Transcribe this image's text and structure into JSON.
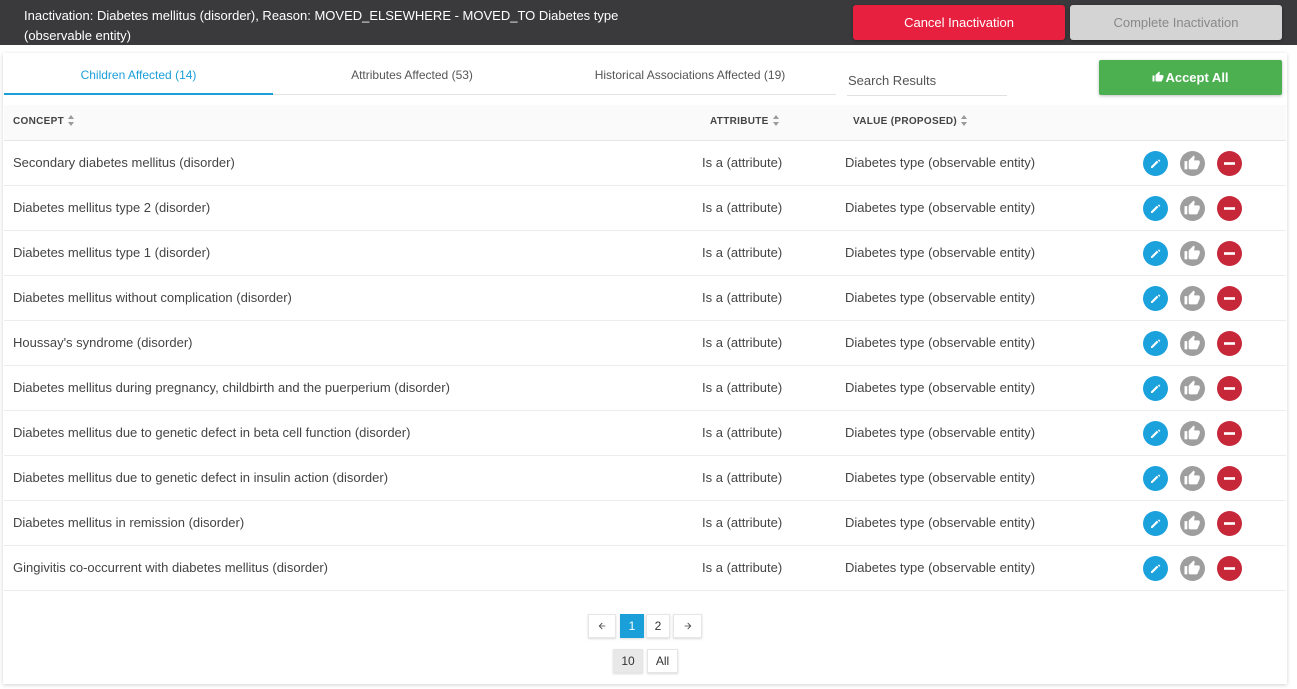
{
  "header": {
    "message": "Inactivation: Diabetes mellitus (disorder), Reason: MOVED_ELSEWHERE - MOVED_TO Diabetes type (observable entity)",
    "cancel_label": "Cancel Inactivation",
    "complete_label": "Complete Inactivation"
  },
  "tabs": [
    {
      "label": "Children Affected (14)",
      "active": true
    },
    {
      "label": "Attributes Affected (53)",
      "active": false
    },
    {
      "label": "Historical Associations Affected (19)",
      "active": false
    }
  ],
  "search": {
    "placeholder": "Search Results"
  },
  "accept_all_label": "Accept All",
  "columns": {
    "concept": "CONCEPT",
    "attribute": "ATTRIBUTE",
    "value": "VALUE (PROPOSED)"
  },
  "rows": [
    {
      "concept": "Secondary diabetes mellitus (disorder)",
      "attribute": "Is a (attribute)",
      "value": "Diabetes type (observable entity)"
    },
    {
      "concept": "Diabetes mellitus type 2 (disorder)",
      "attribute": "Is a (attribute)",
      "value": "Diabetes type (observable entity)"
    },
    {
      "concept": "Diabetes mellitus type 1 (disorder)",
      "attribute": "Is a (attribute)",
      "value": "Diabetes type (observable entity)"
    },
    {
      "concept": "Diabetes mellitus without complication (disorder)",
      "attribute": "Is a (attribute)",
      "value": "Diabetes type (observable entity)"
    },
    {
      "concept": "Houssay's syndrome (disorder)",
      "attribute": "Is a (attribute)",
      "value": "Diabetes type (observable entity)"
    },
    {
      "concept": "Diabetes mellitus during pregnancy, childbirth and the puerperium (disorder)",
      "attribute": "Is a (attribute)",
      "value": "Diabetes type (observable entity)"
    },
    {
      "concept": "Diabetes mellitus due to genetic defect in beta cell function (disorder)",
      "attribute": "Is a (attribute)",
      "value": "Diabetes type (observable entity)"
    },
    {
      "concept": "Diabetes mellitus due to genetic defect in insulin action (disorder)",
      "attribute": "Is a (attribute)",
      "value": "Diabetes type (observable entity)"
    },
    {
      "concept": "Diabetes mellitus in remission (disorder)",
      "attribute": "Is a (attribute)",
      "value": "Diabetes type (observable entity)"
    },
    {
      "concept": "Gingivitis co-occurrent with diabetes mellitus (disorder)",
      "attribute": "Is a (attribute)",
      "value": "Diabetes type (observable entity)"
    }
  ],
  "row_actions": {
    "edit_icon": "pencil-icon",
    "accept_icon": "thumbs-up-icon",
    "remove_icon": "minus-circle-icon"
  },
  "pagination": {
    "pages": [
      "1",
      "2"
    ],
    "current_page": "1",
    "page_sizes": [
      "10",
      "All"
    ],
    "selected_page_size": "10"
  },
  "colors": {
    "cancel": "#e8203f",
    "accept": "#4caf50",
    "accent": "#1a9fd8",
    "remove": "#c6283a"
  }
}
